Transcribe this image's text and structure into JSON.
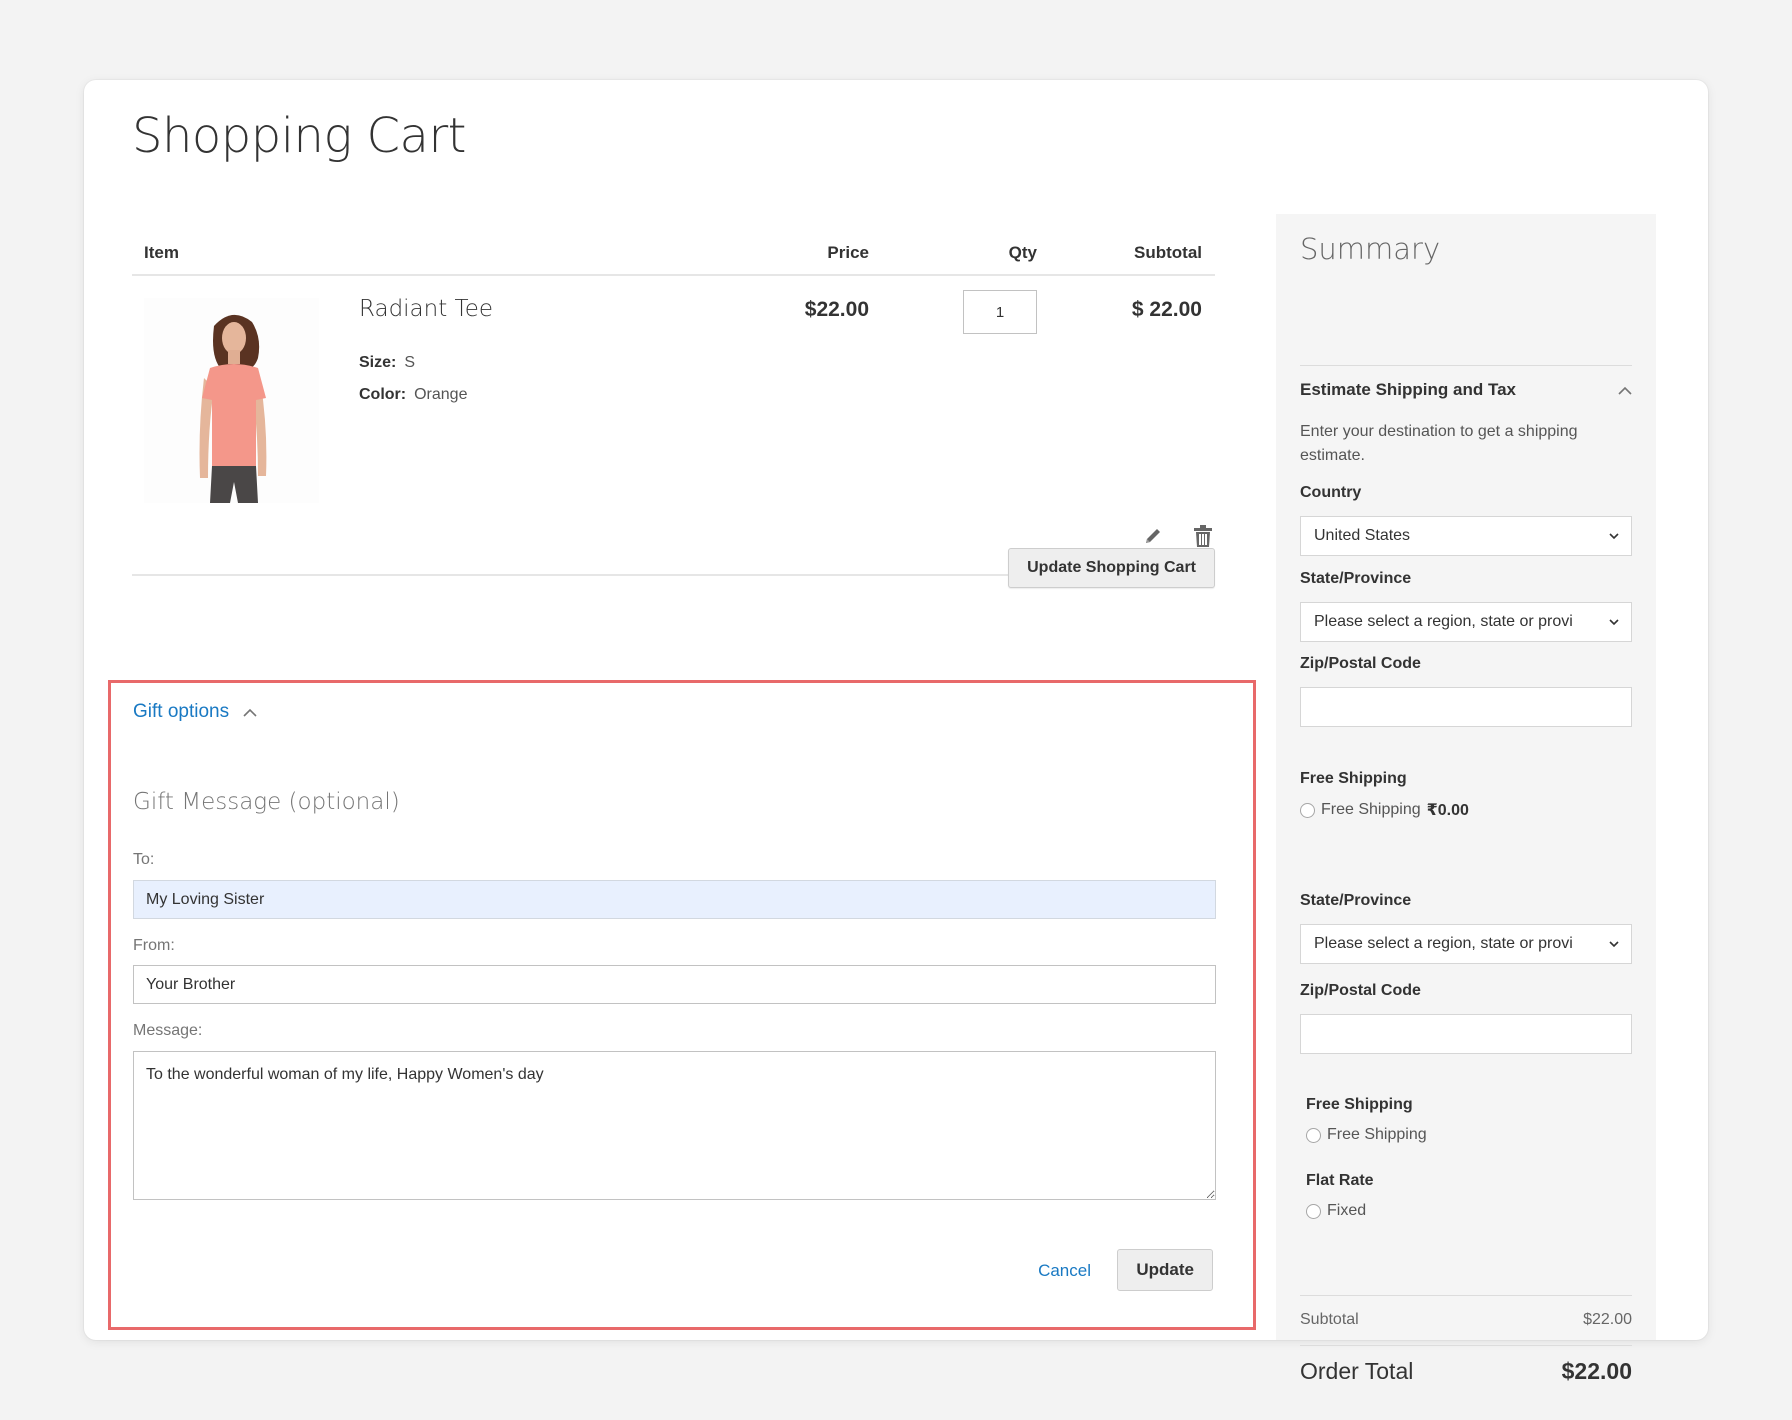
{
  "page": {
    "title": "Shopping Cart"
  },
  "cart": {
    "columns": {
      "item": "Item",
      "price": "Price",
      "qty": "Qty",
      "subtotal": "Subtotal"
    },
    "items": [
      {
        "name": "Radiant Tee",
        "options": [
          {
            "label": "Size:",
            "value": "S"
          },
          {
            "label": "Color:",
            "value": "Orange"
          }
        ],
        "price": "$22.00",
        "qty": "1",
        "subtotal": "$ 22.00",
        "image_icon": "product-photo-woman-orange-tee"
      }
    ],
    "actions": {
      "edit_icon": "pencil-icon",
      "delete_icon": "trash-icon"
    },
    "update_button": "Update Shopping Cart"
  },
  "gift": {
    "toggle_label": "Gift options",
    "title": "Gift Message (optional)",
    "to_label": "To:",
    "to_value": "My Loving Sister",
    "from_label": "From:",
    "from_value": "Your Brother",
    "message_label": "Message:",
    "message_value": "To the wonderful woman of my life, Happy Women's day",
    "cancel_label": "Cancel",
    "update_label": "Update",
    "highlight_color": "#e8696a"
  },
  "summary": {
    "title": "Summary",
    "estimate_title": "Estimate Shipping and Tax",
    "estimate_desc": "Enter your destination to get a shipping estimate.",
    "country_label": "Country",
    "country_value": "United States",
    "state_label": "State/Province",
    "state_placeholder": "Please select a region, state or provi",
    "zip_label": "Zip/Postal Code",
    "zip_value": "",
    "method_group_1": {
      "title": "Free Shipping",
      "option": "Free Shipping",
      "price": "₹0.00"
    },
    "state_label_2": "State/Province",
    "state_placeholder_2": "Please select a region, state or provi",
    "zip_label_2": "Zip/Postal Code",
    "zip_value_2": "",
    "method_group_2": {
      "title": "Free Shipping",
      "option": "Free Shipping"
    },
    "method_group_3": {
      "title": "Flat Rate",
      "option": "Fixed"
    },
    "subtotal_label": "Subtotal",
    "subtotal_value": "$22.00",
    "order_total_label": "Order Total",
    "order_total_value": "$22.00"
  },
  "colors": {
    "link": "#1979c3",
    "summary_bg": "#f5f5f5",
    "autofill_bg": "#e8f0fe"
  }
}
